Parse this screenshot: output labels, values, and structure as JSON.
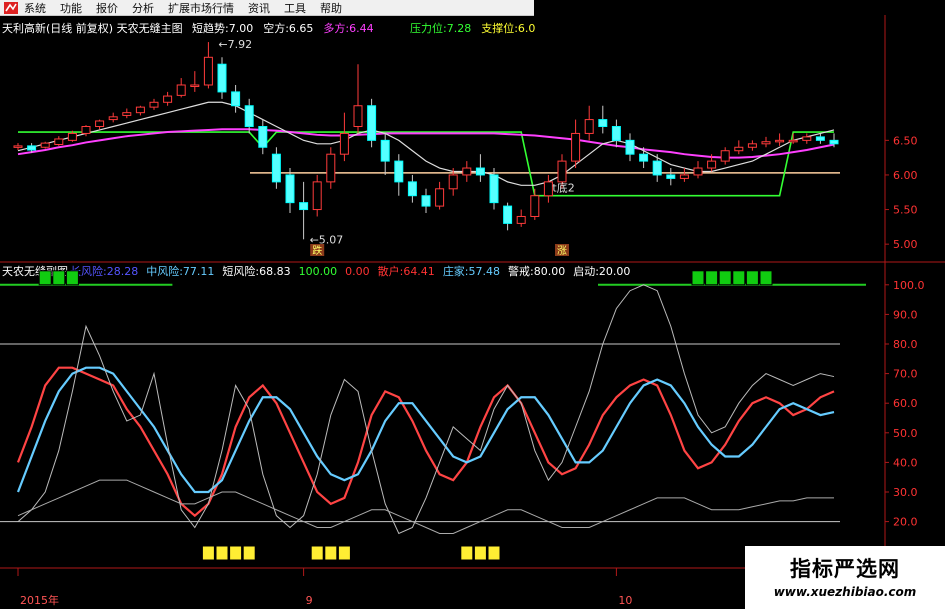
{
  "menu": [
    "系统",
    "功能",
    "报价",
    "分析",
    "扩展市场行情",
    "资讯",
    "工具",
    "帮助"
  ],
  "main_header": {
    "title": "天利高新(日线 前复权) 天农无缝主图",
    "items": [
      {
        "label": "短趋势:",
        "value": "7.00",
        "color": "#ffffff"
      },
      {
        "label": "空方:",
        "value": "6.65",
        "color": "#ffffff"
      },
      {
        "label": "多方:",
        "value": "6.44",
        "color": "#ff40ff"
      }
    ],
    "right_items": [
      {
        "label": "压力位:",
        "value": "7.28",
        "color": "#33ff33"
      },
      {
        "label": "支撑位:",
        "value": "6.0",
        "color": "#ffff33"
      }
    ]
  },
  "sub_header": {
    "title": "天农无缝副图",
    "items": [
      {
        "label": "长风险:",
        "value": "28.28",
        "color": "#5555ff"
      },
      {
        "label": "中风险:",
        "value": "77.11",
        "color": "#66ccff"
      },
      {
        "label": "短风险:",
        "value": "68.83",
        "color": "#ffffff"
      },
      {
        "label": "",
        "value": "100.00",
        "color": "#33ff33"
      },
      {
        "label": "",
        "value": "0.00",
        "color": "#ff3333"
      },
      {
        "label": "散户:",
        "value": "64.41",
        "color": "#ff3333"
      },
      {
        "label": "庄家:",
        "value": "57.48",
        "color": "#66ccff"
      },
      {
        "label": "警戒:",
        "value": "80.00",
        "color": "#ffffff"
      },
      {
        "label": "启动:",
        "value": "20.00",
        "color": "#ffffff"
      }
    ]
  },
  "annotations": {
    "high": "7.92",
    "low": "5.07",
    "bottom": "t底2",
    "sell": "跌",
    "buy": "涨"
  },
  "date_labels": [
    "2015年",
    "9",
    "10"
  ],
  "watermark": {
    "line1": "指标严选网",
    "line2": "www.xuezhibiao.com"
  },
  "chart_data": [
    {
      "type": "candlestick",
      "name": "天利高新(日线 前复权)",
      "ylim": [
        4.8,
        7.95
      ],
      "y_ticks": [
        6.5,
        6.0,
        5.5,
        5.0
      ],
      "candles": [
        [
          6.4,
          6.42,
          6.46,
          6.36
        ],
        [
          6.42,
          6.36,
          6.46,
          6.32
        ],
        [
          6.4,
          6.46,
          6.48,
          6.38
        ],
        [
          6.44,
          6.52,
          6.56,
          6.42
        ],
        [
          6.5,
          6.6,
          6.64,
          6.48
        ],
        [
          6.6,
          6.7,
          6.72,
          6.56
        ],
        [
          6.7,
          6.78,
          6.8,
          6.66
        ],
        [
          6.8,
          6.84,
          6.9,
          6.76
        ],
        [
          6.86,
          6.9,
          6.96,
          6.82
        ],
        [
          6.9,
          6.98,
          7.0,
          6.86
        ],
        [
          6.98,
          7.05,
          7.1,
          6.94
        ],
        [
          7.05,
          7.14,
          7.2,
          7.0
        ],
        [
          7.15,
          7.3,
          7.4,
          7.12
        ],
        [
          7.3,
          7.3,
          7.5,
          7.2
        ],
        [
          7.3,
          7.7,
          7.92,
          7.25
        ],
        [
          7.6,
          7.2,
          7.7,
          7.1
        ],
        [
          7.2,
          7.0,
          7.3,
          6.9
        ],
        [
          7.0,
          6.7,
          7.1,
          6.6
        ],
        [
          6.7,
          6.4,
          6.8,
          6.3
        ],
        [
          6.3,
          5.9,
          6.4,
          5.8
        ],
        [
          6.0,
          5.6,
          6.1,
          5.45
        ],
        [
          5.6,
          5.5,
          5.9,
          5.07
        ],
        [
          5.5,
          5.9,
          6.0,
          5.4
        ],
        [
          5.9,
          6.3,
          6.4,
          5.8
        ],
        [
          6.3,
          6.6,
          6.9,
          6.2
        ],
        [
          6.7,
          7.0,
          7.6,
          6.6
        ],
        [
          7.0,
          6.5,
          7.1,
          6.4
        ],
        [
          6.5,
          6.2,
          6.6,
          6.0
        ],
        [
          6.2,
          5.9,
          6.3,
          5.7
        ],
        [
          5.9,
          5.7,
          6.0,
          5.6
        ],
        [
          5.7,
          5.55,
          5.8,
          5.45
        ],
        [
          5.55,
          5.8,
          5.9,
          5.5
        ],
        [
          5.8,
          6.0,
          6.1,
          5.7
        ],
        [
          6.0,
          6.1,
          6.2,
          5.9
        ],
        [
          6.1,
          6.0,
          6.3,
          5.9
        ],
        [
          6.0,
          5.6,
          6.1,
          5.5
        ],
        [
          5.55,
          5.3,
          5.6,
          5.2
        ],
        [
          5.3,
          5.4,
          5.5,
          5.25
        ],
        [
          5.4,
          5.7,
          5.8,
          5.35
        ],
        [
          5.7,
          5.9,
          6.0,
          5.6
        ],
        [
          5.9,
          6.2,
          6.3,
          5.8
        ],
        [
          6.2,
          6.6,
          6.8,
          6.1
        ],
        [
          6.6,
          6.8,
          7.0,
          6.5
        ],
        [
          6.8,
          6.7,
          7.0,
          6.6
        ],
        [
          6.7,
          6.5,
          6.8,
          6.4
        ],
        [
          6.5,
          6.3,
          6.6,
          6.2
        ],
        [
          6.3,
          6.2,
          6.4,
          6.1
        ],
        [
          6.2,
          6.0,
          6.3,
          5.9
        ],
        [
          6.0,
          5.95,
          6.1,
          5.85
        ],
        [
          5.95,
          6.0,
          6.1,
          5.9
        ],
        [
          6.0,
          6.1,
          6.2,
          5.95
        ],
        [
          6.1,
          6.2,
          6.3,
          6.05
        ],
        [
          6.2,
          6.35,
          6.4,
          6.15
        ],
        [
          6.35,
          6.4,
          6.5,
          6.3
        ],
        [
          6.4,
          6.45,
          6.5,
          6.35
        ],
        [
          6.45,
          6.48,
          6.55,
          6.4
        ],
        [
          6.48,
          6.5,
          6.6,
          6.42
        ],
        [
          6.5,
          6.5,
          6.6,
          6.45
        ],
        [
          6.5,
          6.55,
          6.6,
          6.45
        ],
        [
          6.55,
          6.5,
          6.6,
          6.45
        ],
        [
          6.5,
          6.45,
          6.6,
          6.4
        ]
      ],
      "ma": [
        {
          "name": "多方",
          "color": "#ff40ff",
          "values": [
            6.3,
            6.33,
            6.36,
            6.4,
            6.43,
            6.47,
            6.5,
            6.53,
            6.56,
            6.58,
            6.6,
            6.62,
            6.63,
            6.64,
            6.65,
            6.66,
            6.66,
            6.66,
            6.65,
            6.64,
            6.62,
            6.6,
            6.58,
            6.57,
            6.57,
            6.58,
            6.59,
            6.6,
            6.6,
            6.6,
            6.6,
            6.6,
            6.6,
            6.6,
            6.6,
            6.6,
            6.59,
            6.58,
            6.57,
            6.55,
            6.53,
            6.51,
            6.48,
            6.45,
            6.42,
            6.4,
            6.37,
            6.35,
            6.33,
            6.3,
            6.28,
            6.26,
            6.25,
            6.25,
            6.26,
            6.28,
            6.3,
            6.33,
            6.36,
            6.4,
            6.44
          ]
        },
        {
          "name": "空方",
          "color": "#dddddd",
          "values": [
            6.35,
            6.4,
            6.45,
            6.5,
            6.55,
            6.6,
            6.65,
            6.7,
            6.75,
            6.8,
            6.85,
            6.9,
            6.95,
            7.0,
            7.05,
            7.05,
            7.0,
            6.9,
            6.8,
            6.7,
            6.6,
            6.5,
            6.45,
            6.45,
            6.5,
            6.6,
            6.65,
            6.6,
            6.5,
            6.35,
            6.2,
            6.1,
            6.05,
            6.05,
            6.05,
            6.0,
            5.9,
            5.85,
            5.85,
            5.9,
            6.0,
            6.15,
            6.3,
            6.45,
            6.5,
            6.45,
            6.35,
            6.25,
            6.15,
            6.1,
            6.05,
            6.05,
            6.1,
            6.15,
            6.2,
            6.3,
            6.4,
            6.5,
            6.55,
            6.6,
            6.65
          ]
        }
      ],
      "stepline": {
        "name": "压力/支撑",
        "color": "#33ff33",
        "values": [
          6.62,
          6.62,
          6.62,
          6.62,
          6.62,
          6.62,
          6.62,
          6.62,
          6.62,
          6.62,
          6.62,
          6.62,
          6.62,
          6.62,
          6.62,
          6.62,
          6.62,
          6.62,
          6.4,
          6.62,
          6.62,
          6.62,
          6.62,
          6.62,
          6.62,
          6.62,
          6.62,
          6.62,
          6.62,
          6.62,
          6.62,
          6.62,
          6.62,
          6.62,
          6.62,
          6.62,
          6.62,
          6.62,
          5.7,
          5.7,
          5.7,
          5.7,
          5.7,
          5.7,
          5.7,
          5.7,
          5.7,
          5.7,
          5.7,
          5.7,
          5.7,
          5.7,
          5.7,
          5.7,
          5.7,
          5.7,
          5.7,
          6.62,
          6.62,
          6.62,
          6.62
        ]
      },
      "support": 6.03,
      "resistance": 7.28
    },
    {
      "type": "line",
      "name": "天农无缝副图",
      "ylim": [
        5,
        105
      ],
      "y_ticks": [
        100,
        90,
        80,
        70,
        60,
        50,
        40,
        30,
        20
      ],
      "hlines": [
        80,
        20
      ],
      "series": [
        {
          "name": "散户",
          "color": "#ff4444",
          "values": [
            40,
            52,
            66,
            72,
            72,
            70,
            68,
            66,
            58,
            52,
            44,
            36,
            26,
            22,
            26,
            36,
            52,
            62,
            66,
            60,
            50,
            40,
            30,
            26,
            28,
            40,
            56,
            64,
            62,
            54,
            44,
            36,
            34,
            40,
            52,
            62,
            66,
            60,
            50,
            40,
            36,
            38,
            46,
            56,
            62,
            66,
            68,
            66,
            56,
            44,
            38,
            40,
            46,
            54,
            60,
            62,
            60,
            56,
            58,
            62,
            64
          ]
        },
        {
          "name": "庄家",
          "color": "#66ccff",
          "values": [
            30,
            42,
            54,
            64,
            70,
            72,
            72,
            70,
            64,
            58,
            52,
            44,
            36,
            30,
            30,
            34,
            44,
            54,
            62,
            62,
            58,
            50,
            42,
            36,
            34,
            36,
            44,
            54,
            60,
            60,
            54,
            48,
            42,
            40,
            42,
            50,
            58,
            62,
            62,
            56,
            48,
            40,
            40,
            44,
            52,
            60,
            66,
            68,
            66,
            60,
            52,
            46,
            42,
            42,
            46,
            52,
            58,
            60,
            58,
            56,
            57
          ]
        },
        {
          "name": "短风险",
          "color": "#bbbbbb",
          "values": [
            20,
            24,
            30,
            44,
            64,
            86,
            76,
            64,
            54,
            56,
            70,
            46,
            24,
            18,
            26,
            44,
            66,
            58,
            36,
            22,
            18,
            22,
            36,
            56,
            68,
            64,
            44,
            26,
            16,
            18,
            28,
            40,
            52,
            48,
            44,
            58,
            66,
            60,
            44,
            34,
            40,
            52,
            64,
            80,
            92,
            98,
            100,
            98,
            86,
            70,
            56,
            50,
            52,
            60,
            66,
            70,
            68,
            66,
            68,
            70,
            69
          ]
        },
        {
          "name": "长风险",
          "color": "#aaaaaa",
          "values": [
            22,
            24,
            26,
            28,
            30,
            32,
            34,
            34,
            34,
            32,
            30,
            28,
            26,
            26,
            28,
            30,
            30,
            28,
            26,
            24,
            22,
            20,
            18,
            18,
            20,
            22,
            24,
            24,
            22,
            20,
            18,
            16,
            16,
            18,
            20,
            22,
            24,
            24,
            22,
            20,
            18,
            18,
            18,
            20,
            22,
            24,
            26,
            28,
            28,
            28,
            26,
            24,
            24,
            24,
            25,
            26,
            27,
            27,
            28,
            28,
            28
          ]
        }
      ],
      "top_signals": [
        [
          2,
          4
        ],
        [
          50,
          55
        ]
      ],
      "bottom_signals": [
        [
          14,
          17
        ],
        [
          22,
          24
        ],
        [
          33,
          35
        ]
      ]
    }
  ]
}
